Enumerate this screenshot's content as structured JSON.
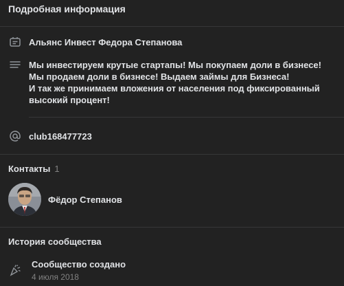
{
  "header": {
    "title": "Подробная информация"
  },
  "info": {
    "name": "Альянс Инвест Федора Степанова",
    "description": "Мы инвестируем крутые стартапы! Мы покупаем доли в бизнесе! Мы продаем доли в бизнесе! Выдаем займы для Бизнеса!\nИ так же принимаем вложения от населения под фиксированный высокий процент!",
    "address": "club168477723"
  },
  "contacts": {
    "title": "Контакты",
    "count": "1",
    "items": [
      {
        "name": "Фёдор Степанов"
      }
    ]
  },
  "history": {
    "title": "История сообщества",
    "event": "Сообщество создано",
    "date": "4 июля 2018"
  },
  "icons": {
    "name_icon": "card-icon",
    "description_icon": "text-lines-icon",
    "address_icon": "at-icon",
    "history_icon": "party-popper-icon"
  },
  "colors": {
    "background": "#222222",
    "text": "#e1e3e6",
    "secondary": "#828282",
    "icon": "#909499",
    "divider": "#363738"
  }
}
